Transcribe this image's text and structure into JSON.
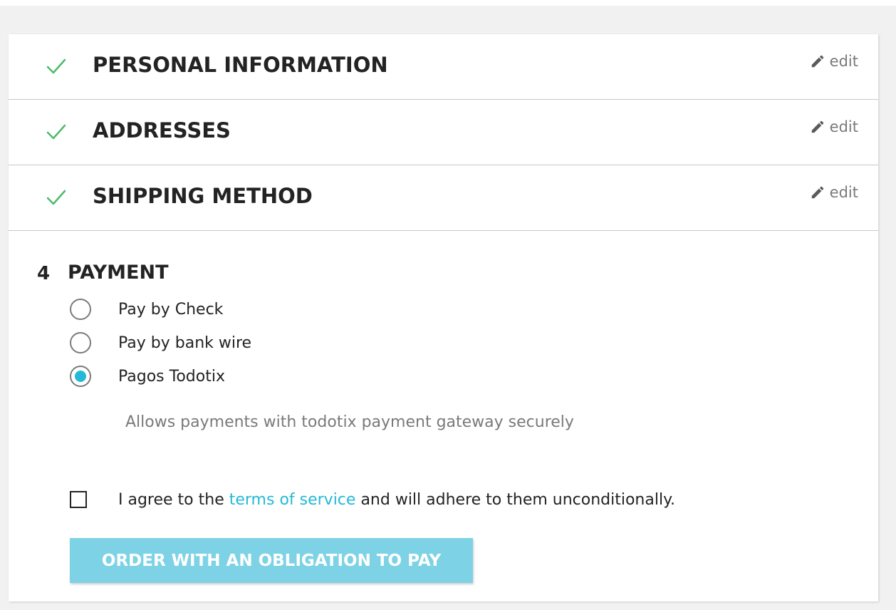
{
  "colors": {
    "check": "#4cbb6c",
    "accent": "#24b9d7",
    "button_bg": "#7dd3e5",
    "muted": "#7a7a7a"
  },
  "steps": [
    {
      "title": "Personal Information",
      "edit_label": "edit",
      "status_icon": "check-icon"
    },
    {
      "title": "Addresses",
      "edit_label": "edit",
      "status_icon": "check-icon"
    },
    {
      "title": "Shipping Method",
      "edit_label": "edit",
      "status_icon": "check-icon"
    }
  ],
  "payment": {
    "number": "4",
    "title": "PAYMENT",
    "options": [
      {
        "label": "Pay by Check",
        "selected": false
      },
      {
        "label": "Pay by bank wire",
        "selected": false
      },
      {
        "label": "Pagos Todotix",
        "selected": true
      }
    ],
    "description": "Allows payments with todotix payment gateway securely",
    "terms": {
      "prefix": "I agree to the ",
      "link": "terms of service",
      "suffix": " and will adhere to them unconditionally.",
      "checked": false
    },
    "order_button": "ORDER WITH AN OBLIGATION TO PAY"
  }
}
